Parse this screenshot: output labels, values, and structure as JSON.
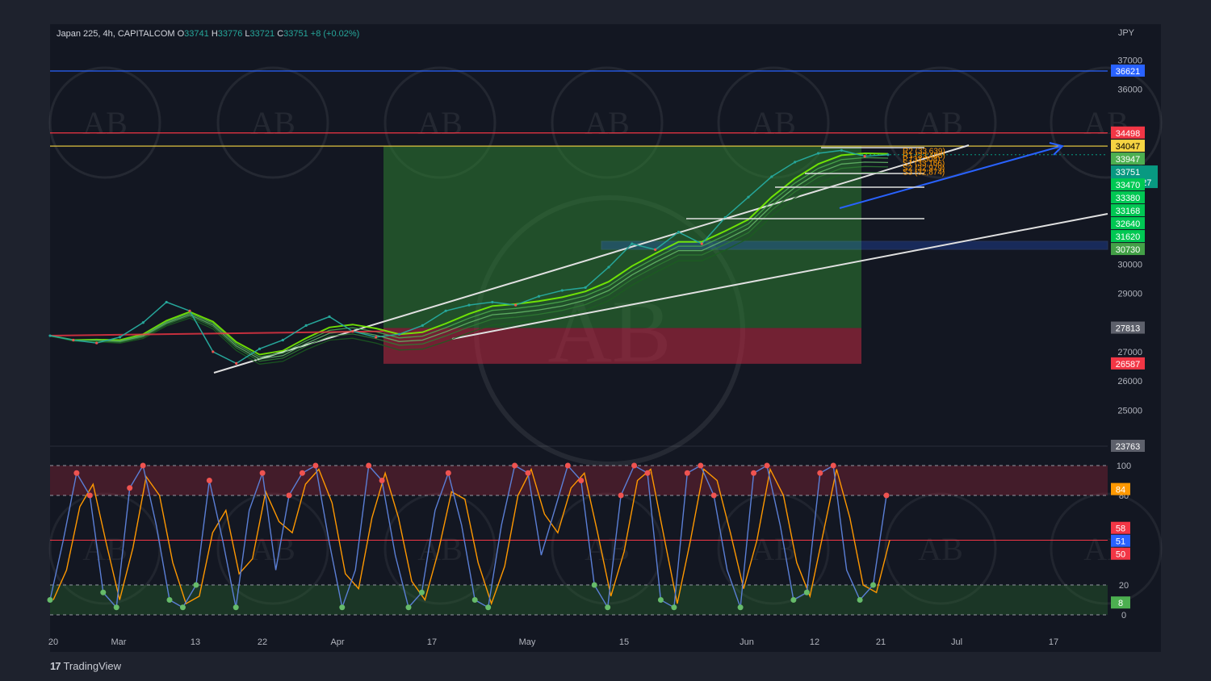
{
  "header": {
    "symbol": "Japan 225, 4h, CAPITALCOM",
    "o_label": "O",
    "o_value": "33741",
    "h_label": "H",
    "h_value": "33776",
    "l_label": "L",
    "l_value": "33721",
    "c_label": "C",
    "c_value": "33751",
    "change": "+8 (+0.02%)"
  },
  "currency": "JPY",
  "brand": "TradingView",
  "watermark_text": "AB",
  "colors": {
    "background": "#131722",
    "frame": "#1e222d",
    "up": "#26a69a",
    "green_zone": "#2e7d32",
    "red_zone": "#b2283f",
    "blue_line": "#2962ff",
    "red_line": "#f23645",
    "yellow_line": "#f5d442",
    "stoch_k": "#5b7fd6",
    "stoch_d": "#ff9800"
  },
  "chart_data": [
    {
      "type": "line",
      "title": "Japan 225, 4h, CAPITALCOM",
      "ylabel": "JPY",
      "x": [
        "Feb 20",
        "Mar 1",
        "Mar 13",
        "Mar 22",
        "Apr 1",
        "Apr 17",
        "May 1",
        "May 15",
        "Jun 1",
        "Jun 12",
        "Jun 21",
        "Jul 1",
        "Jul 17"
      ],
      "x_tick_labels": [
        "20",
        "Mar",
        "13",
        "22",
        "Apr",
        "17",
        "May",
        "15",
        "Jun",
        "12",
        "21",
        "Jul",
        "17"
      ],
      "ylim": [
        23763,
        37450
      ],
      "y_ticks": [
        37000,
        36000,
        30000,
        29000,
        27000,
        26000,
        25000
      ],
      "series": [
        {
          "values": [
            27550,
            27400,
            27300,
            27500,
            28000,
            28700,
            28400,
            27000,
            26600,
            27100,
            27400,
            27900,
            28200,
            27700,
            27500,
            27600,
            27900,
            28400,
            28600,
            28700,
            28600,
            28900,
            29100,
            29200,
            29900,
            30700,
            30500,
            31100,
            30700,
            31600,
            32300,
            33000,
            33500,
            33800,
            33900,
            33700,
            33751
          ]
        }
      ],
      "price_labels": [
        {
          "value": 36621,
          "text": "36621",
          "color": "#2962ff"
        },
        {
          "value": 34498,
          "text": "34498",
          "color": "#f23645"
        },
        {
          "value": 34047,
          "text": "34047",
          "color": "#f5d442"
        },
        {
          "value": 33947,
          "text": "33947",
          "color": "#4caf50"
        },
        {
          "value": 33751,
          "text": "33751",
          "color": "#089981"
        },
        {
          "value": 33470,
          "text": "33470",
          "color": "#00c853"
        },
        {
          "value": 33380,
          "text": "33380",
          "color": "#00c853"
        },
        {
          "value": 33168,
          "text": "33168",
          "color": "#00c853"
        },
        {
          "value": 32640,
          "text": "32640",
          "color": "#00c853"
        },
        {
          "value": 31620,
          "text": "31620",
          "color": "#00c853"
        },
        {
          "value": 30730,
          "text": "30730",
          "color": "#43a047"
        },
        {
          "value": 27813,
          "text": "27813",
          "color": "#5d606b"
        },
        {
          "value": 26587,
          "text": "26587",
          "color": "#f23645"
        },
        {
          "value": 23763,
          "text": "23763",
          "color": "#5d606b"
        }
      ],
      "countdown": "03:28:27",
      "horizontal_lines": [
        {
          "value": 36621,
          "color": "#2962ff"
        },
        {
          "value": 34498,
          "color": "#f23645"
        },
        {
          "value": 34047,
          "color": "#f5d442"
        }
      ],
      "pivot_labels": [
        {
          "text": "R2 (33,639)",
          "value": 33900
        },
        {
          "text": "R1 (33,498)",
          "value": 33750
        },
        {
          "text": "P (33,308)",
          "value": 33620
        },
        {
          "text": "S1 (33,166)",
          "value": 33480
        },
        {
          "text": "S2 (32,979)",
          "value": 33310
        },
        {
          "text": "S3 (32,874)",
          "value": 33180
        }
      ]
    },
    {
      "type": "line",
      "title": "",
      "ylim": [
        0,
        100
      ],
      "y_ticks": [
        100,
        80,
        20,
        0
      ],
      "y_tick_labels": [
        "100",
        "80",
        "20",
        "0"
      ],
      "series": [
        {
          "values": [
            10,
            50,
            95,
            80,
            15,
            5,
            85,
            100,
            60,
            10,
            5,
            20,
            90,
            50,
            5,
            70,
            95,
            30,
            80,
            95,
            100,
            50,
            5,
            30,
            100,
            90,
            40,
            5,
            15,
            70,
            95,
            60,
            10,
            5,
            60,
            100,
            95,
            40,
            70,
            100,
            90,
            20,
            5,
            80,
            100,
            95,
            10,
            5,
            95,
            100,
            80,
            30,
            5,
            95,
            100,
            60,
            10,
            15,
            95,
            100,
            30,
            10,
            20,
            80
          ]
        }
      ],
      "price_labels": [
        {
          "value": 84,
          "text": "84",
          "color": "#ff9800"
        },
        {
          "value": 58,
          "text": "58",
          "color": "#f23645"
        },
        {
          "value": 51,
          "text": "51",
          "color": "#2962ff"
        },
        {
          "value": 50,
          "text": "50",
          "color": "#f23645"
        },
        {
          "value": 8,
          "text": "8",
          "color": "#4caf50"
        }
      ]
    }
  ]
}
